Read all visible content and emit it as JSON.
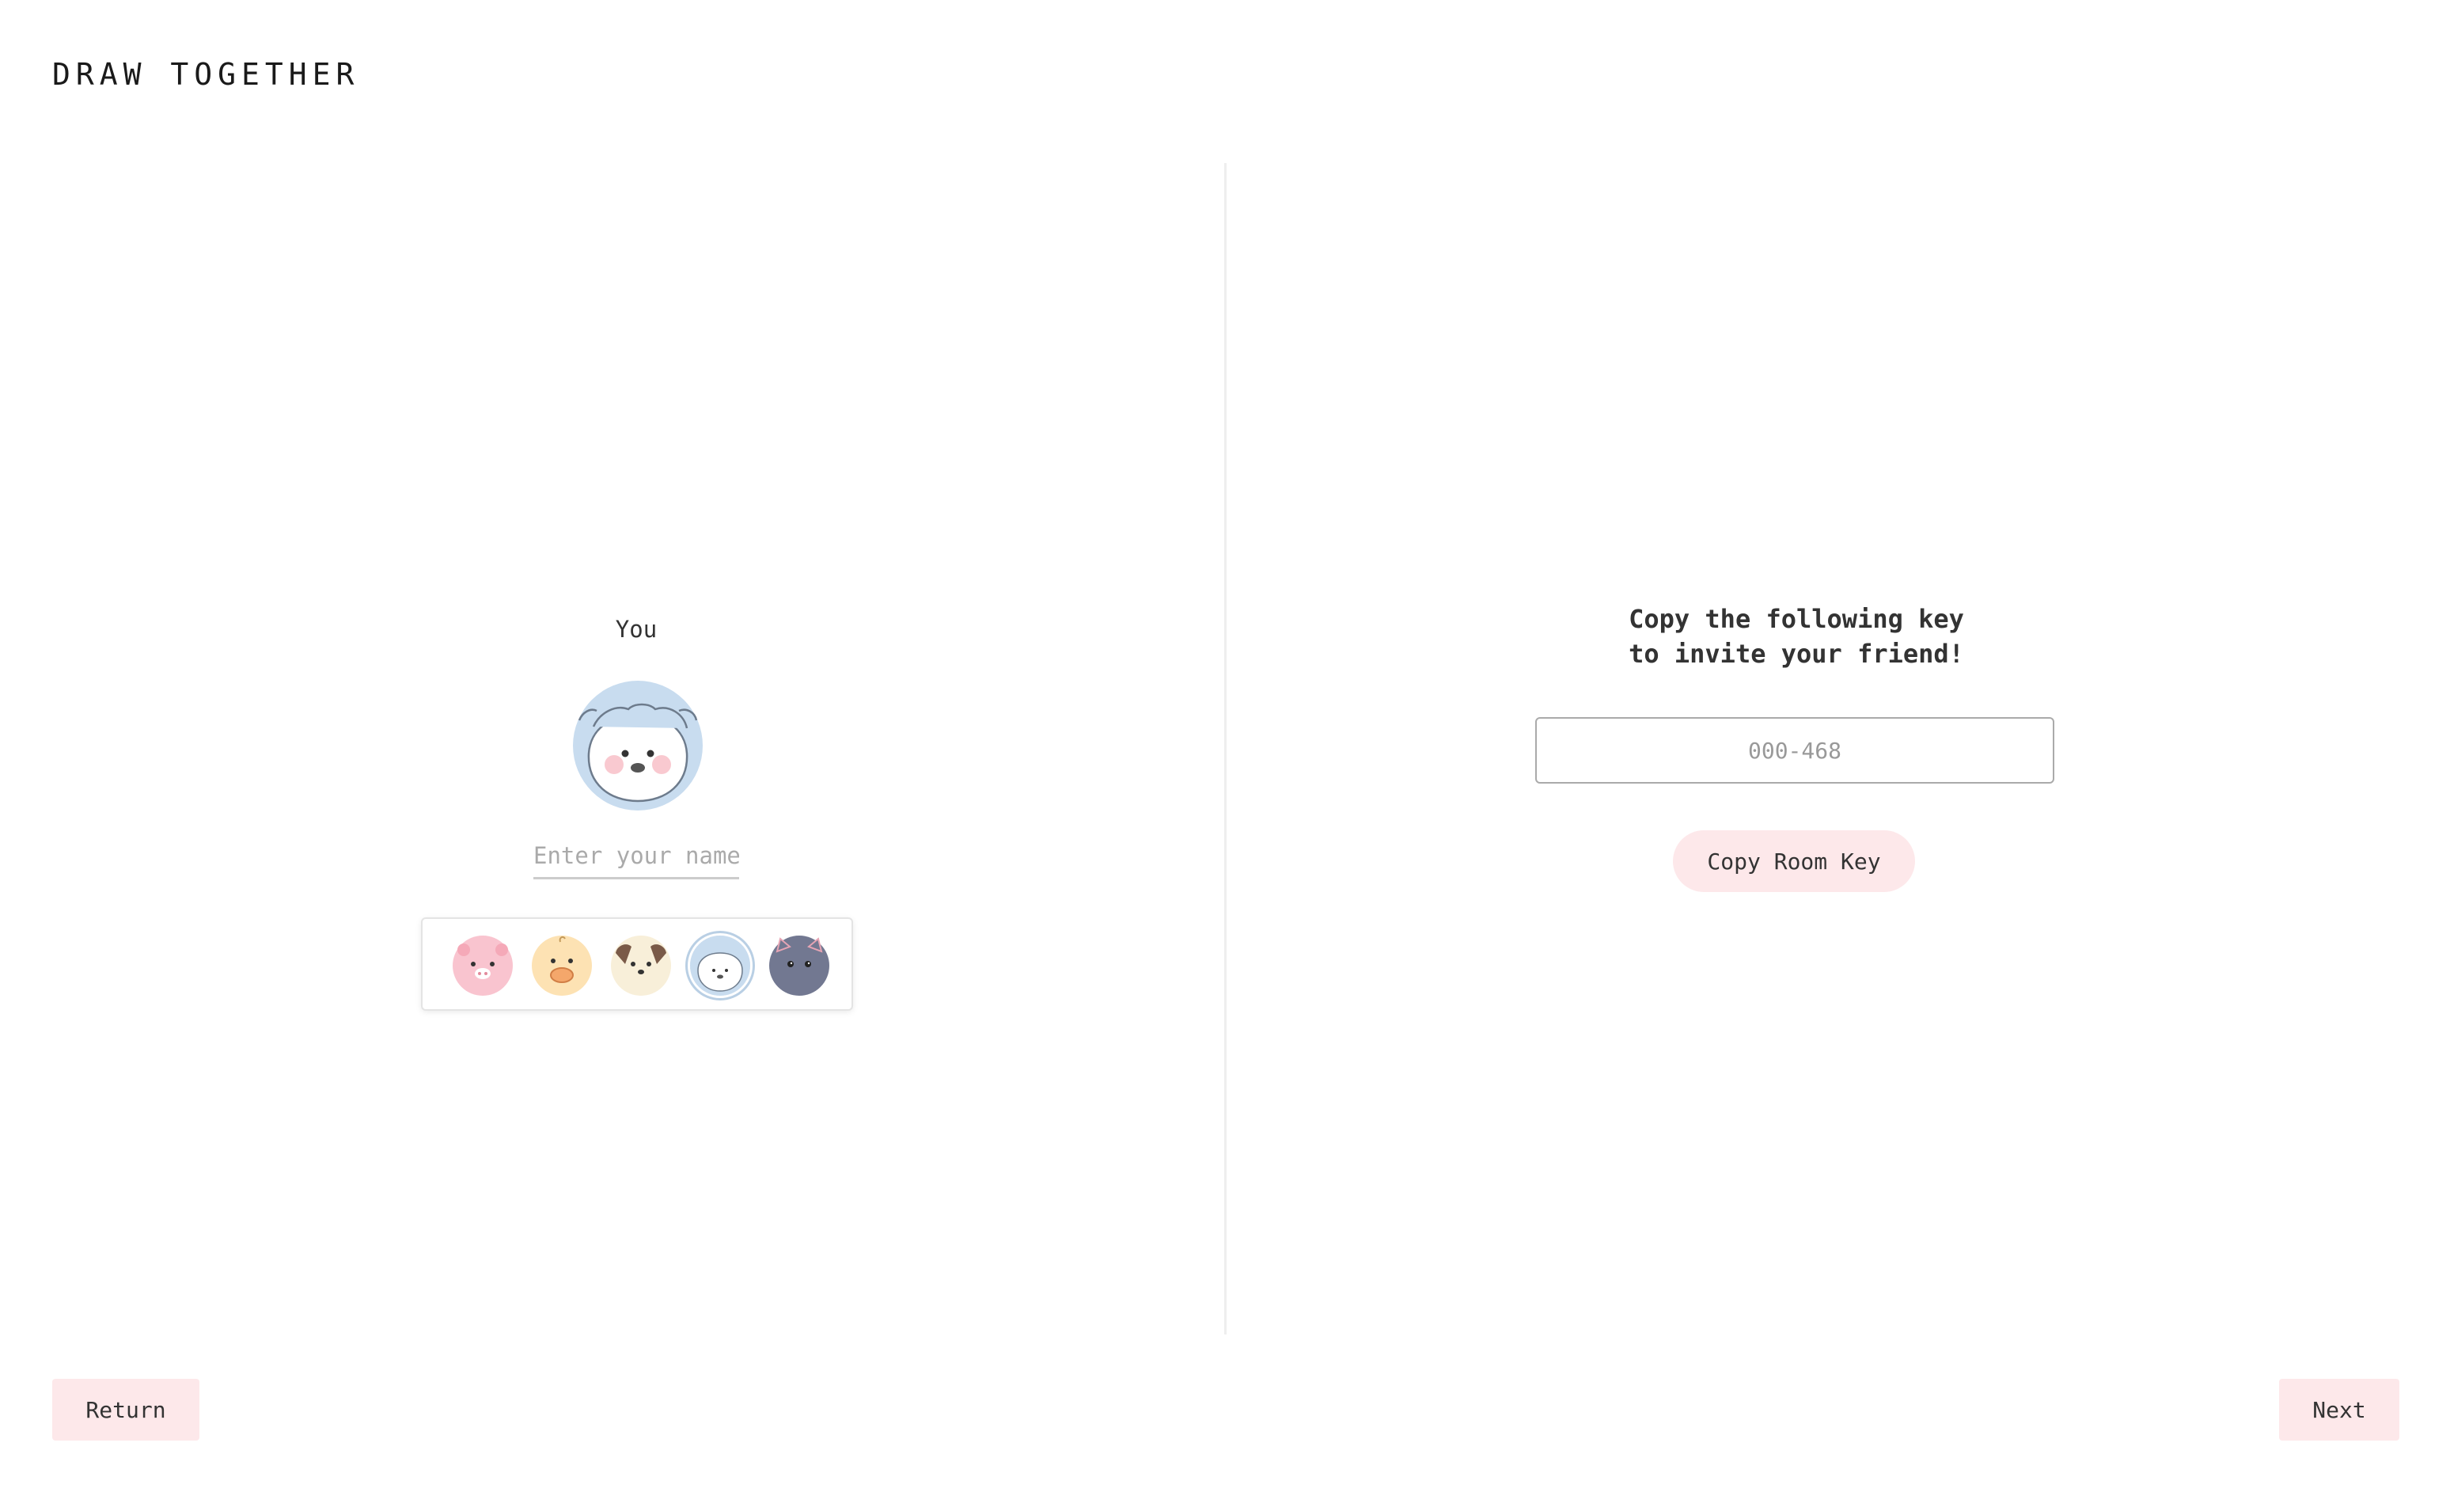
{
  "app": {
    "title": "DRAW TOGETHER"
  },
  "player": {
    "label": "You",
    "name_value": "",
    "name_placeholder": "Enter your name",
    "selected_avatar": "sheep",
    "avatars": [
      {
        "name": "pig-avatar-icon",
        "color": "#f9c4cf"
      },
      {
        "name": "chick-avatar-icon",
        "color": "#fde2b3"
      },
      {
        "name": "puppy-avatar-icon",
        "color": "#f8efd9"
      },
      {
        "name": "sheep-avatar-icon",
        "color": "#c8dcef"
      },
      {
        "name": "cat-avatar-icon",
        "color": "#727891"
      }
    ]
  },
  "invite": {
    "heading_line1": "Copy the following key",
    "heading_line2": "to invite your friend!",
    "room_key": "000-468",
    "copy_button_label": "Copy Room Key"
  },
  "footer": {
    "return_label": "Return",
    "next_label": "Next"
  },
  "colors": {
    "button_bg": "#fde8ea",
    "accent_blue": "#c8dcef",
    "divider": "#eeeeee"
  }
}
